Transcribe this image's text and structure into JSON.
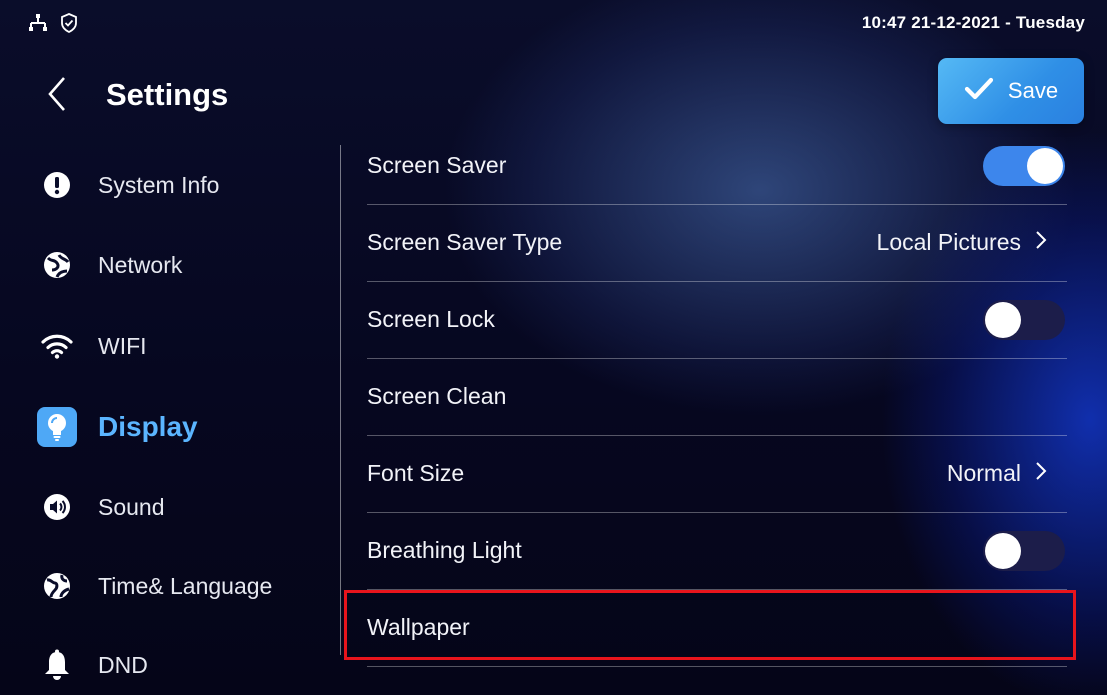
{
  "status_bar": {
    "datetime": "10:47  21-12-2021 - Tuesday",
    "icons": [
      "network-icon",
      "shield-icon"
    ]
  },
  "header": {
    "title": "Settings",
    "back_icon": "chevron-left-icon",
    "save_label": "Save",
    "save_icon": "check-icon"
  },
  "sidebar": {
    "items": [
      {
        "label": "System Info",
        "icon": "info-icon"
      },
      {
        "label": "Network",
        "icon": "network-globe-icon"
      },
      {
        "label": "WIFI",
        "icon": "wifi-icon"
      },
      {
        "label": "Display",
        "icon": "display-bulb-icon",
        "active": true
      },
      {
        "label": "Sound",
        "icon": "sound-icon"
      },
      {
        "label": "Time& Language",
        "icon": "globe-icon"
      },
      {
        "label": "DND",
        "icon": "bell-icon"
      }
    ]
  },
  "settings": {
    "rows": [
      {
        "label": "Screen Saver",
        "control": "toggle",
        "state": "on"
      },
      {
        "label": "Screen Saver Type",
        "control": "value",
        "value": "Local Pictures"
      },
      {
        "label": "Screen Lock",
        "control": "toggle",
        "state": "off"
      },
      {
        "label": "Screen Clean",
        "control": "none"
      },
      {
        "label": "Font Size",
        "control": "value",
        "value": "Normal"
      },
      {
        "label": "Breathing Light",
        "control": "toggle",
        "state": "off"
      },
      {
        "label": "Wallpaper",
        "control": "none",
        "highlighted": true
      }
    ]
  },
  "colors": {
    "accent": "#4ea8f6",
    "toggle_on": "#3d86ec",
    "toggle_off": "#1c1d4a",
    "highlight": "#e8141c"
  }
}
